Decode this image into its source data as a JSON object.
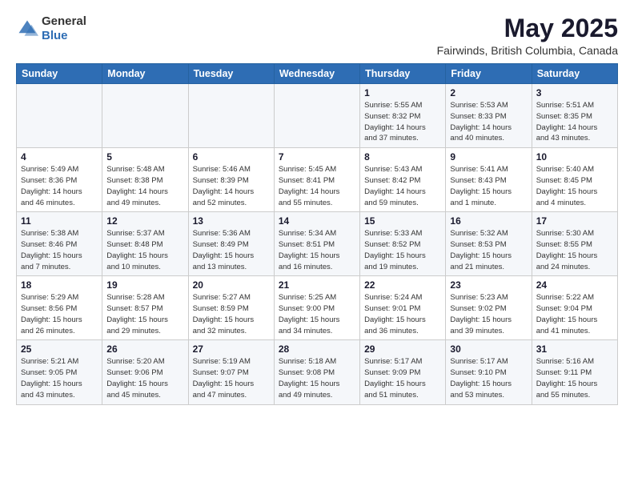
{
  "logo": {
    "general": "General",
    "blue": "Blue"
  },
  "title": {
    "month_year": "May 2025",
    "location": "Fairwinds, British Columbia, Canada"
  },
  "weekdays": [
    "Sunday",
    "Monday",
    "Tuesday",
    "Wednesday",
    "Thursday",
    "Friday",
    "Saturday"
  ],
  "weeks": [
    [
      {
        "day": "",
        "info": ""
      },
      {
        "day": "",
        "info": ""
      },
      {
        "day": "",
        "info": ""
      },
      {
        "day": "",
        "info": ""
      },
      {
        "day": "1",
        "info": "Sunrise: 5:55 AM\nSunset: 8:32 PM\nDaylight: 14 hours\nand 37 minutes."
      },
      {
        "day": "2",
        "info": "Sunrise: 5:53 AM\nSunset: 8:33 PM\nDaylight: 14 hours\nand 40 minutes."
      },
      {
        "day": "3",
        "info": "Sunrise: 5:51 AM\nSunset: 8:35 PM\nDaylight: 14 hours\nand 43 minutes."
      }
    ],
    [
      {
        "day": "4",
        "info": "Sunrise: 5:49 AM\nSunset: 8:36 PM\nDaylight: 14 hours\nand 46 minutes."
      },
      {
        "day": "5",
        "info": "Sunrise: 5:48 AM\nSunset: 8:38 PM\nDaylight: 14 hours\nand 49 minutes."
      },
      {
        "day": "6",
        "info": "Sunrise: 5:46 AM\nSunset: 8:39 PM\nDaylight: 14 hours\nand 52 minutes."
      },
      {
        "day": "7",
        "info": "Sunrise: 5:45 AM\nSunset: 8:41 PM\nDaylight: 14 hours\nand 55 minutes."
      },
      {
        "day": "8",
        "info": "Sunrise: 5:43 AM\nSunset: 8:42 PM\nDaylight: 14 hours\nand 59 minutes."
      },
      {
        "day": "9",
        "info": "Sunrise: 5:41 AM\nSunset: 8:43 PM\nDaylight: 15 hours\nand 1 minute."
      },
      {
        "day": "10",
        "info": "Sunrise: 5:40 AM\nSunset: 8:45 PM\nDaylight: 15 hours\nand 4 minutes."
      }
    ],
    [
      {
        "day": "11",
        "info": "Sunrise: 5:38 AM\nSunset: 8:46 PM\nDaylight: 15 hours\nand 7 minutes."
      },
      {
        "day": "12",
        "info": "Sunrise: 5:37 AM\nSunset: 8:48 PM\nDaylight: 15 hours\nand 10 minutes."
      },
      {
        "day": "13",
        "info": "Sunrise: 5:36 AM\nSunset: 8:49 PM\nDaylight: 15 hours\nand 13 minutes."
      },
      {
        "day": "14",
        "info": "Sunrise: 5:34 AM\nSunset: 8:51 PM\nDaylight: 15 hours\nand 16 minutes."
      },
      {
        "day": "15",
        "info": "Sunrise: 5:33 AM\nSunset: 8:52 PM\nDaylight: 15 hours\nand 19 minutes."
      },
      {
        "day": "16",
        "info": "Sunrise: 5:32 AM\nSunset: 8:53 PM\nDaylight: 15 hours\nand 21 minutes."
      },
      {
        "day": "17",
        "info": "Sunrise: 5:30 AM\nSunset: 8:55 PM\nDaylight: 15 hours\nand 24 minutes."
      }
    ],
    [
      {
        "day": "18",
        "info": "Sunrise: 5:29 AM\nSunset: 8:56 PM\nDaylight: 15 hours\nand 26 minutes."
      },
      {
        "day": "19",
        "info": "Sunrise: 5:28 AM\nSunset: 8:57 PM\nDaylight: 15 hours\nand 29 minutes."
      },
      {
        "day": "20",
        "info": "Sunrise: 5:27 AM\nSunset: 8:59 PM\nDaylight: 15 hours\nand 32 minutes."
      },
      {
        "day": "21",
        "info": "Sunrise: 5:25 AM\nSunset: 9:00 PM\nDaylight: 15 hours\nand 34 minutes."
      },
      {
        "day": "22",
        "info": "Sunrise: 5:24 AM\nSunset: 9:01 PM\nDaylight: 15 hours\nand 36 minutes."
      },
      {
        "day": "23",
        "info": "Sunrise: 5:23 AM\nSunset: 9:02 PM\nDaylight: 15 hours\nand 39 minutes."
      },
      {
        "day": "24",
        "info": "Sunrise: 5:22 AM\nSunset: 9:04 PM\nDaylight: 15 hours\nand 41 minutes."
      }
    ],
    [
      {
        "day": "25",
        "info": "Sunrise: 5:21 AM\nSunset: 9:05 PM\nDaylight: 15 hours\nand 43 minutes."
      },
      {
        "day": "26",
        "info": "Sunrise: 5:20 AM\nSunset: 9:06 PM\nDaylight: 15 hours\nand 45 minutes."
      },
      {
        "day": "27",
        "info": "Sunrise: 5:19 AM\nSunset: 9:07 PM\nDaylight: 15 hours\nand 47 minutes."
      },
      {
        "day": "28",
        "info": "Sunrise: 5:18 AM\nSunset: 9:08 PM\nDaylight: 15 hours\nand 49 minutes."
      },
      {
        "day": "29",
        "info": "Sunrise: 5:17 AM\nSunset: 9:09 PM\nDaylight: 15 hours\nand 51 minutes."
      },
      {
        "day": "30",
        "info": "Sunrise: 5:17 AM\nSunset: 9:10 PM\nDaylight: 15 hours\nand 53 minutes."
      },
      {
        "day": "31",
        "info": "Sunrise: 5:16 AM\nSunset: 9:11 PM\nDaylight: 15 hours\nand 55 minutes."
      }
    ]
  ]
}
